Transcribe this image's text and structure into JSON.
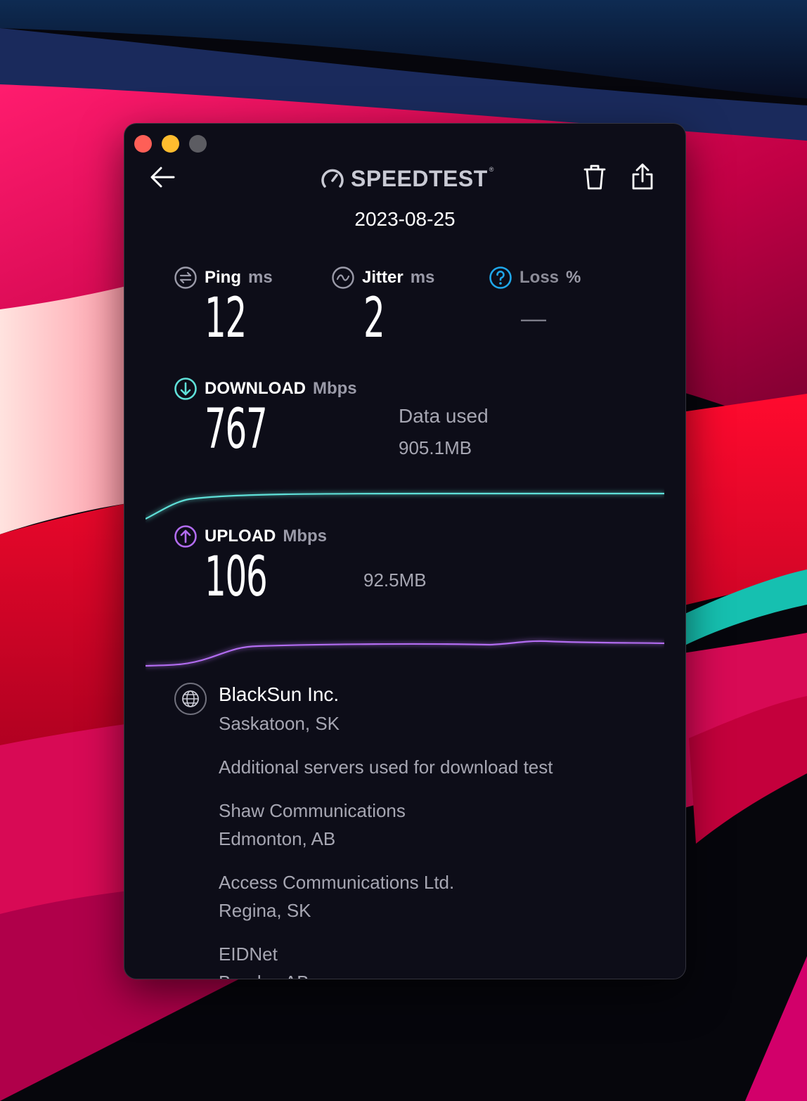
{
  "app": {
    "title": "SPEEDTEST",
    "trademark": "®",
    "date": "2023-08-25"
  },
  "colors": {
    "download_accent": "#5fe0d8",
    "upload_accent": "#b26cf0",
    "loss_accent": "#1fa7ea"
  },
  "metrics": {
    "ping": {
      "label": "Ping",
      "unit": "ms",
      "value": "12"
    },
    "jitter": {
      "label": "Jitter",
      "unit": "ms",
      "value": "2"
    },
    "loss": {
      "label": "Loss",
      "unit": "%",
      "value": "—"
    }
  },
  "download": {
    "label": "DOWNLOAD",
    "unit": "Mbps",
    "value": "767",
    "data_used_label": "Data used",
    "data_used": "905.1MB"
  },
  "upload": {
    "label": "UPLOAD",
    "unit": "Mbps",
    "value": "106",
    "data_used": "92.5MB"
  },
  "server": {
    "name": "BlackSun Inc.",
    "location": "Saskatoon, SK",
    "additional_heading": "Additional servers used for download test",
    "additional": [
      {
        "name": "Shaw Communications",
        "location": "Edmonton, AB"
      },
      {
        "name": "Access Communications Ltd.",
        "location": "Regina, SK"
      },
      {
        "name": "EIDNet",
        "location": "Brooks, AB"
      }
    ]
  },
  "icons": {
    "back": "back-arrow-icon",
    "logo": "speedometer-icon",
    "trash": "trash-icon",
    "share": "share-icon",
    "ping": "ping-icon",
    "jitter": "jitter-icon",
    "loss": "help-circle-icon",
    "download": "download-arrow-icon",
    "upload": "upload-arrow-icon",
    "server": "globe-icon"
  }
}
